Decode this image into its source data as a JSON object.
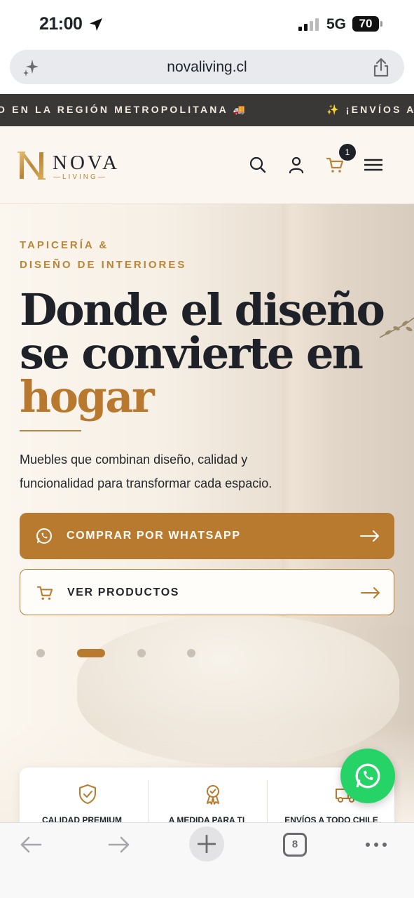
{
  "status_bar": {
    "time": "21:00",
    "network": "5G",
    "battery": "70"
  },
  "browser": {
    "url": "novaliving.cl",
    "tab_count": "8"
  },
  "ticker": {
    "text_1": "O EN LA REGIÓN METROPOLITANA 🚚",
    "text_2": "✨ ¡ENVÍOS A"
  },
  "header": {
    "brand_name": "NOVA",
    "brand_sub": "—LIVING—",
    "cart_count": "1"
  },
  "hero": {
    "eyebrow_line1": "TAPICERÍA &",
    "eyebrow_line2": "DISEÑO DE INTERIORES",
    "heading_line1": "Donde el diseño",
    "heading_line2": "se convierte en",
    "heading_accent": "hogar",
    "lede": "Muebles que combinan diseño, calidad y funcionalidad para transformar cada espacio.",
    "primary_cta": "COMPRAR POR WHATSAPP",
    "secondary_cta": "VER PRODUCTOS",
    "carousel_active_index": 1,
    "carousel_count": 4
  },
  "features": [
    {
      "label": "CALIDAD PREMIUM",
      "icon": "shield-check-icon"
    },
    {
      "label": "A MEDIDA PARA TI",
      "icon": "award-ribbon-icon"
    },
    {
      "label": "ENVÍOS A TODO CHILE",
      "icon": "delivery-truck-icon"
    }
  ],
  "colors": {
    "accent": "#b87a2e",
    "dark": "#1e2228",
    "cream": "#fbf6ef",
    "ticker_bg": "#3a3836",
    "whatsapp": "#25d366"
  }
}
